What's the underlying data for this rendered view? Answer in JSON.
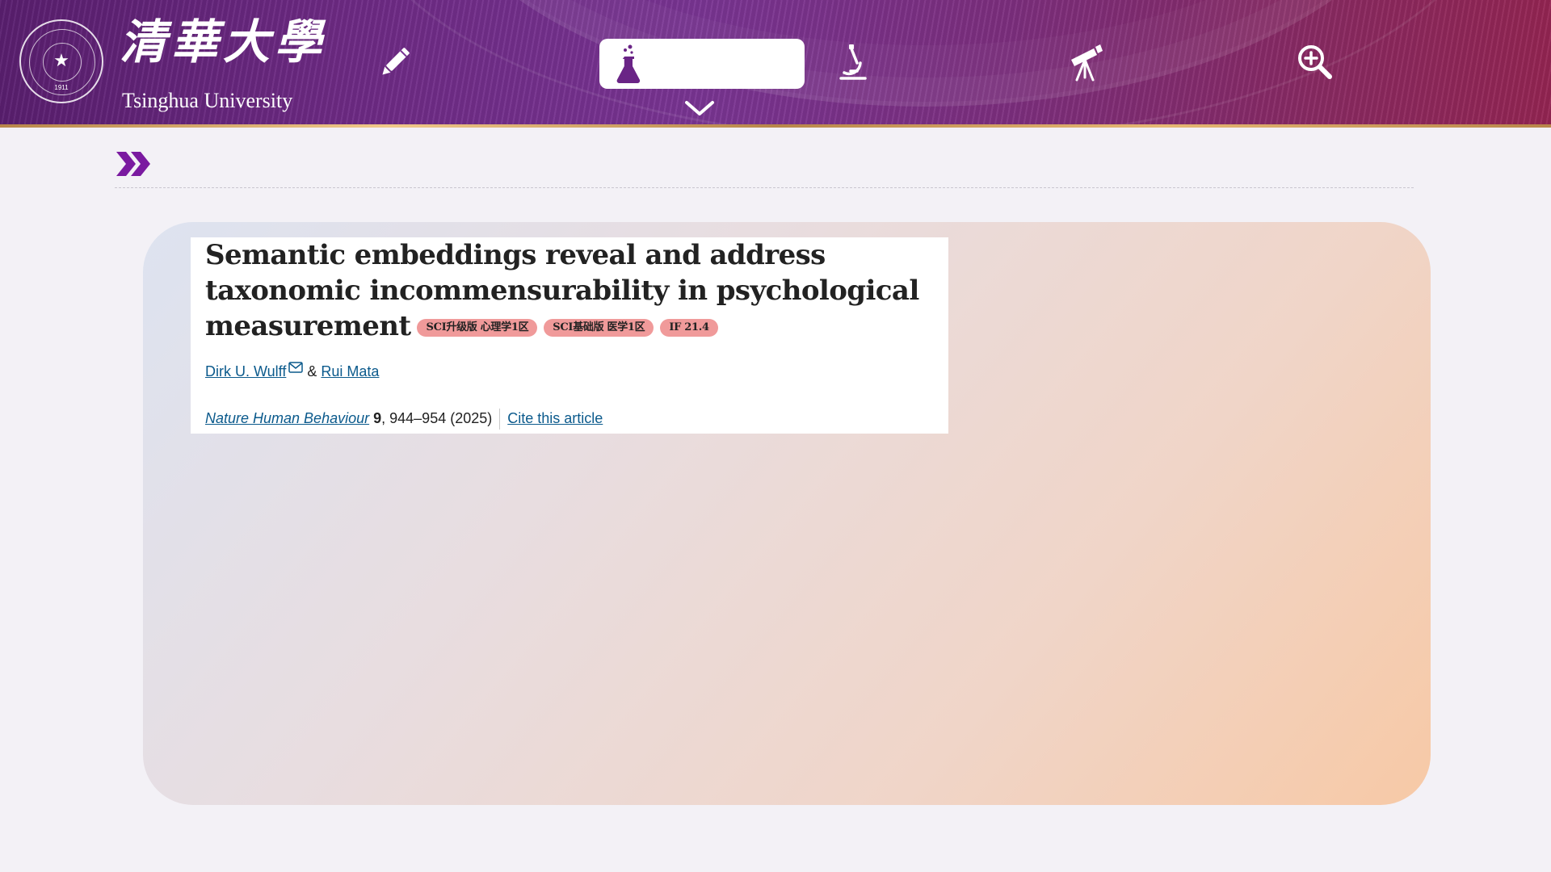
{
  "header": {
    "university_cn": "清華大學",
    "university_en": "Tsinghua University",
    "seal_year": "1911",
    "nav_icons": [
      "pencil-icon",
      "flask-icon",
      "microscope-icon",
      "telescope-icon",
      "zoom-in-icon"
    ],
    "active_tab": "flask-icon",
    "brand_color": "#6e2a85"
  },
  "section": {
    "arrow_icon": "double-chevron-right-icon"
  },
  "article": {
    "title": "Semantic embeddings reveal and address taxonomic incommensurability in psychological measurement",
    "badges": [
      "SCI升级版 心理学1区",
      "SCI基础版 医学1区",
      "IF 21.4"
    ],
    "authors": [
      "Dirk U. Wulff",
      "Rui Mata"
    ],
    "author_separator": "&",
    "journal": "Nature Human Behaviour",
    "volume": "9",
    "pages_year": ", 944–954 (2025)",
    "cite_label": "Cite this article"
  }
}
